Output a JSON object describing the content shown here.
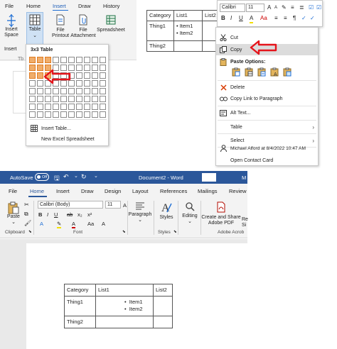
{
  "insert_panel": {
    "tabs": [
      "File",
      "Home",
      "Insert",
      "Draw",
      "History"
    ],
    "ribbon": {
      "insert_space": [
        "Insert",
        "Space"
      ],
      "table": "Table",
      "file_printout": [
        "File",
        "Printout"
      ],
      "file_attachment": [
        "File",
        "Attachment"
      ],
      "spreadsheet": "Spreadsheet",
      "group_insert": "Insert",
      "group_tables_fragment": "Tb"
    },
    "grid_popup": {
      "header": "3x3 Table",
      "columns": 10,
      "rows": 8,
      "highlight_columns": 3,
      "highlight_rows": 3,
      "items": [
        "Insert Table...",
        "New Excel Spreadsheet"
      ]
    },
    "arrow_color": "#e5141b"
  },
  "context_panel": {
    "preview_table": {
      "header": [
        "Category",
        "List1",
        "List2"
      ],
      "row1_label": "Thing1",
      "row1_items": [
        "Item1",
        "Item2"
      ],
      "row2_label": "Thing2"
    },
    "mini_toolbar": {
      "font": "Calibri",
      "size": "11",
      "buttons": [
        "B",
        "I",
        "U",
        "A",
        "Aa",
        "≡",
        "≡",
        "¶",
        "✓",
        "✓"
      ]
    },
    "menu": {
      "cut": "Cut",
      "copy": "Copy",
      "paste_options": "Paste Options:",
      "delete": "Delete",
      "copy_link": "Copy Link to Paragraph",
      "alt_text": "Alt Text...",
      "table": "Table",
      "select": "Select",
      "author": "Michael Alford at 8/4/2022 10:47 AM",
      "open_contact": "Open Contact Card"
    }
  },
  "word_panel": {
    "titlebar": {
      "autosave": "AutoSave",
      "toggle": "Off",
      "doc_title": "Document2 - Word",
      "fragment": "M"
    },
    "tabs": [
      "File",
      "Home",
      "Insert",
      "Draw",
      "Design",
      "Layout",
      "References",
      "Mailings",
      "Review"
    ],
    "active_tab": "Home",
    "ribbon": {
      "paste": "Paste",
      "font_name": "Calibri (Body)",
      "font_size": "11",
      "paragraph": "Paragraph",
      "styles": "Styles",
      "editing": "Editing",
      "create_share": [
        "Create and Share",
        "Adobe PDF"
      ],
      "sign_fragment": [
        "Re",
        "Si"
      ],
      "groups": {
        "clipboard": "Clipboard",
        "font": "Font",
        "styles": "Styles",
        "adobe": "Adobe Acrob"
      }
    },
    "doc_table": {
      "header": [
        "Category",
        "List1",
        "List2"
      ],
      "row1_label": "Thing1",
      "row1_items": [
        "Item1",
        "Item2"
      ],
      "row2_label": "Thing2"
    }
  }
}
